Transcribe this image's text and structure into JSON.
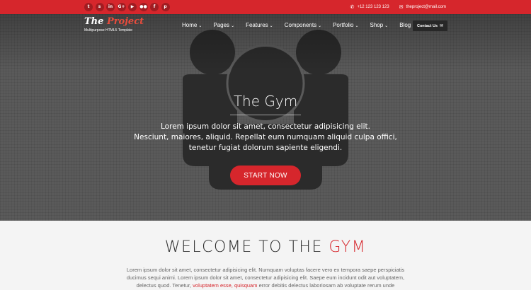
{
  "topbar": {
    "social_icons": [
      {
        "name": "twitter-icon",
        "glyph": "t"
      },
      {
        "name": "skype-icon",
        "glyph": "s"
      },
      {
        "name": "linkedin-icon",
        "glyph": "in"
      },
      {
        "name": "google-plus-icon",
        "glyph": "G+"
      },
      {
        "name": "youtube-icon",
        "glyph": "▶"
      },
      {
        "name": "flickr-icon",
        "glyph": "●●"
      },
      {
        "name": "facebook-icon",
        "glyph": "f"
      },
      {
        "name": "pinterest-icon",
        "glyph": "p"
      }
    ],
    "phone": "+12 123 123 123",
    "email": "theproject@mail.com"
  },
  "header": {
    "logo_part1": "The ",
    "logo_part2": "Project",
    "logo_tagline": "Multipurpose HTML5 Template",
    "nav": [
      {
        "label": "Home",
        "name": "nav-home"
      },
      {
        "label": "Pages",
        "name": "nav-pages"
      },
      {
        "label": "Features",
        "name": "nav-features"
      },
      {
        "label": "Components",
        "name": "nav-components"
      },
      {
        "label": "Portfolio",
        "name": "nav-portfolio"
      },
      {
        "label": "Shop",
        "name": "nav-shop"
      },
      {
        "label": "Blog",
        "name": "nav-blog"
      }
    ],
    "contact_button": "Contact Us"
  },
  "hero": {
    "title": "The Gym",
    "lines": [
      "Lorem ipsum dolor sit amet, consectetur adipisicing elit.",
      "Nesciunt, maiores, aliquid. Repellat eum numquam aliquid culpa offici,",
      "tenetur fugiat dolorum sapiente eligendi."
    ],
    "button": "START NOW"
  },
  "welcome": {
    "title_part1": "WELCOME TO THE ",
    "title_part2": "GYM",
    "line1": "Lorem ipsum dolor sit amet, consectetur adipisicing elit. Numquam voluptas facere vero ex tempora saepe perspiciatis",
    "line2": "ducimus sequi animi. Lorem ipsum dolor sit amet, consectetur adipisicing elit. Saepe eum incidunt odit aut voluptatem,",
    "line3_a": "delectus quod. Tenetur, ",
    "line3_link": "voluptatem esse, quisquam",
    "line3_b": " error debitis delectus laboriosam ab voluptate rerum unde"
  },
  "colors": {
    "accent": "#d6262c",
    "hero_bg": "#5a5a5a",
    "silhouette": "#2b2b2b",
    "contact_button_bg": "#272727"
  }
}
